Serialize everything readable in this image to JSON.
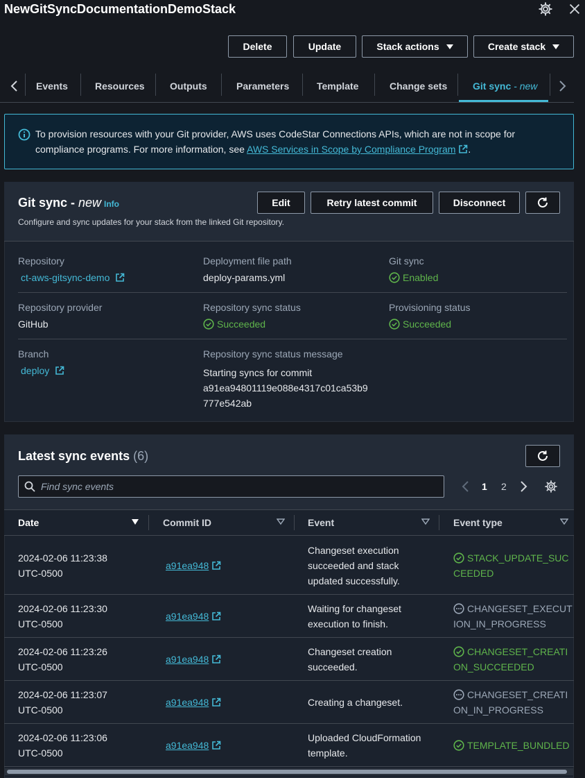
{
  "header": {
    "title": "NewGitSyncDocumentationDemoStack",
    "gear_icon": "gear-icon",
    "close_icon": "close-icon"
  },
  "actions": {
    "delete": "Delete",
    "update": "Update",
    "stack_actions": "Stack actions",
    "create_stack": "Create stack"
  },
  "tabs": {
    "events": "Events",
    "resources": "Resources",
    "outputs": "Outputs",
    "parameters": "Parameters",
    "template": "Template",
    "change_sets": "Change sets",
    "git_sync": "Git sync",
    "git_sync_suffix": "- new"
  },
  "alert": {
    "text": "To provision resources with your Git provider, AWS uses CodeStar Connections APIs, which are not in scope for compliance programs. For more information, see ",
    "link": "AWS Services in Scope by Compliance Program",
    "end": "."
  },
  "gitsync": {
    "title": "Git sync - ",
    "title_new": "new",
    "info": "Info",
    "description": "Configure and sync updates for your stack from the linked Git repository.",
    "edit": "Edit",
    "retry": "Retry latest commit",
    "disconnect": "Disconnect",
    "repository_label": "Repository",
    "repository_value": "ct-aws-gitsync-demo",
    "deploy_path_label": "Deployment file path",
    "deploy_path_value": "deploy-params.yml",
    "gitsync_label": "Git sync",
    "gitsync_value": "Enabled",
    "provider_label": "Repository provider",
    "provider_value": "GitHub",
    "sync_status_label": "Repository sync status",
    "sync_status_value": "Succeeded",
    "prov_status_label": "Provisioning status",
    "prov_status_value": "Succeeded",
    "branch_label": "Branch",
    "branch_value": "deploy",
    "message_label": "Repository sync status message",
    "message_line1": "Starting syncs for commit",
    "message_line2": "a91ea94801119e088e4317c01ca53b9",
    "message_line3": "777e542ab"
  },
  "events": {
    "title": "Latest sync events",
    "count": "(6)",
    "search_placeholder": "Find sync events",
    "page1": "1",
    "page2": "2",
    "col_date": "Date",
    "col_commit": "Commit ID",
    "col_event": "Event",
    "col_type": "Event type",
    "rows": [
      {
        "date1": "2024-02-06 11:23:38",
        "date2": "UTC-0500",
        "commit": "a91ea948",
        "ev1": "Changeset execution",
        "ev2": "succeeded and stack",
        "ev3": "updated successfully.",
        "t1": "STACK_UPDATE_SUC",
        "t2": "CEEDED",
        "status": "success"
      },
      {
        "date1": "2024-02-06 11:23:30",
        "date2": "UTC-0500",
        "commit": "a91ea948",
        "ev1": "Waiting for changeset",
        "ev2": "execution to finish.",
        "t1": "CHANGESET_EXECUT",
        "t2": "ION_IN_PROGRESS",
        "status": "in-progress"
      },
      {
        "date1": "2024-02-06 11:23:26",
        "date2": "UTC-0500",
        "commit": "a91ea948",
        "ev1": "Changeset creation",
        "ev2": "succeeded.",
        "t1": "CHANGESET_CREATI",
        "t2": "ON_SUCCEEDED",
        "status": "success"
      },
      {
        "date1": "2024-02-06 11:23:07",
        "date2": "UTC-0500",
        "commit": "a91ea948",
        "ev1": "Creating a changeset.",
        "t1": "CHANGESET_CREATI",
        "t2": "ON_IN_PROGRESS",
        "status": "in-progress"
      },
      {
        "date1": "2024-02-06 11:23:06",
        "date2": "UTC-0500",
        "commit": "a91ea948",
        "ev1": "Uploaded CloudFormation",
        "ev2": "template.",
        "t1": "TEMPLATE_BUNDLED",
        "status": "success"
      }
    ]
  },
  "colors": {
    "accent": "#44b9d6",
    "success": "#5fb44b",
    "background": "#16191f"
  }
}
